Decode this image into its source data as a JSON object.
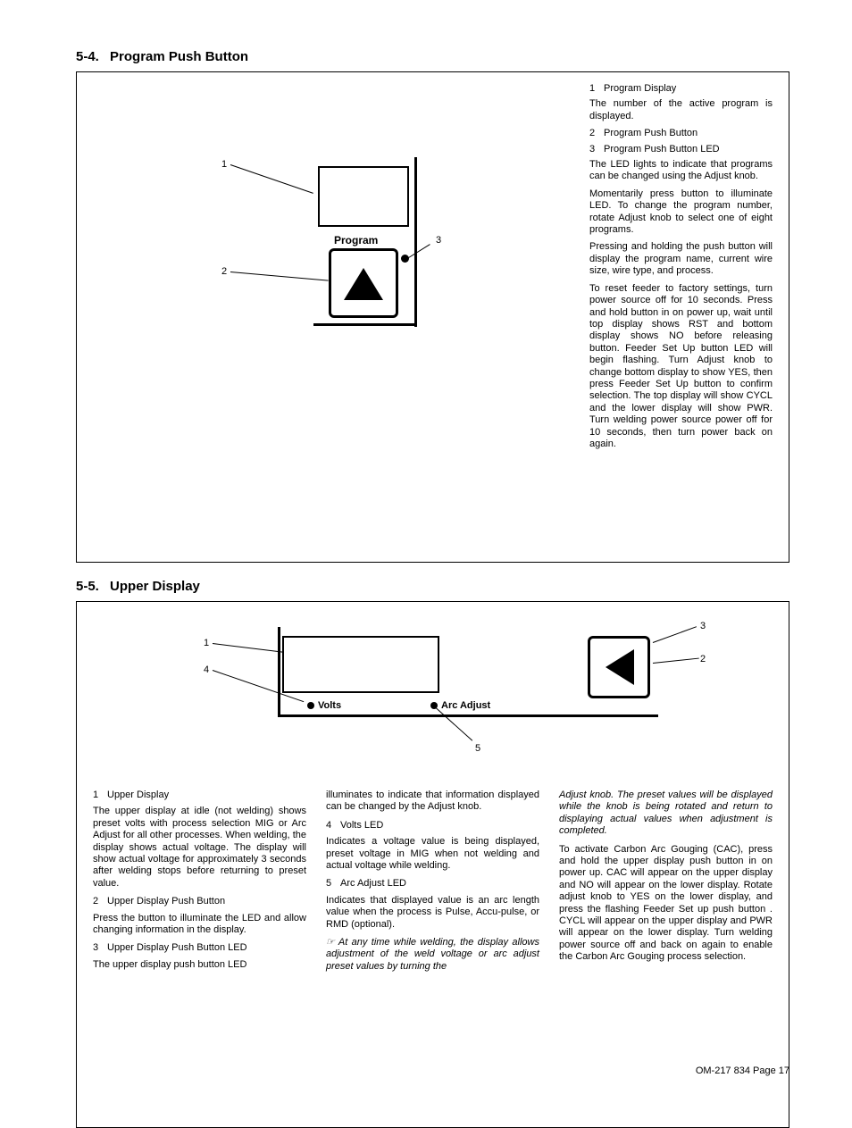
{
  "section1": {
    "number": "5-4.",
    "title": "Program Push Button",
    "diagram": {
      "callout1": "1",
      "callout2": "2",
      "callout3": "3",
      "label": "Program"
    },
    "items": [
      {
        "n": "1",
        "t": "Program Display"
      },
      {
        "n": "2",
        "t": "Program Push Button"
      },
      {
        "n": "3",
        "t": "Program Push Button LED"
      }
    ],
    "p1": "The number of the active program is displayed.",
    "p2": "The LED lights to indicate that programs can be changed using the Adjust knob.",
    "p3": "Momentarily press button to illuminate LED. To change the program number, rotate Adjust knob to select one of eight programs.",
    "p4": "Pressing and holding the push button will display the program name, current wire size, wire type, and process.",
    "p5": "To reset feeder to factory settings, turn power source off for 10 seconds. Press and hold button in on power up, wait until top display shows RST and bottom display shows NO before releasing button. Feeder Set Up button LED will begin flashing. Turn Adjust knob to change bottom display to show YES, then press Feeder Set Up button to confirm selection. The top display will show CYCL and the lower display will show PWR. Turn welding power source power off for 10 seconds, then turn power back on again."
  },
  "section2": {
    "number": "5-5.",
    "title": "Upper Display",
    "diagram": {
      "c1": "1",
      "c2": "2",
      "c3": "3",
      "c4": "4",
      "c5": "5",
      "volts": "Volts",
      "arc": "Arc Adjust"
    },
    "col1": {
      "i1n": "1",
      "i1t": "Upper Display",
      "p1": "The upper display at idle (not welding) shows preset volts with process selection MIG or Arc Adjust for all other processes. When welding, the display shows actual voltage. The display will show actual voltage for approximately 3 seconds after welding stops before returning to preset value.",
      "i2n": "2",
      "i2t": "Upper Display Push Button",
      "p2": "Press the button to illuminate the LED and allow changing information in the display.",
      "i3n": "3",
      "i3t": "Upper Display Push Button LED",
      "p3": "The upper display push button LED"
    },
    "col2": {
      "p1": "illuminates to indicate that information displayed can be changed by the Adjust knob.",
      "i4n": "4",
      "i4t": "Volts LED",
      "p2": "Indicates a voltage value is being displayed, preset voltage in MIG when not welding and actual voltage while welding.",
      "i5n": "5",
      "i5t": "Arc Adjust LED",
      "p3": "Indicates that displayed value is an arc length value when the process is Pulse, Accu-pulse, or RMD (optional).",
      "note": "At any time while welding, the display allows adjustment of the weld voltage or arc adjust preset values by turning the"
    },
    "col3": {
      "noteCont": "Adjust knob. The preset values will be displayed while the knob is being rotated and return to displaying actual values when adjustment is completed.",
      "p1": "To activate Carbon Arc Gouging (CAC), press and hold the upper display push button in on power up. CAC will appear on the upper display and NO will appear on the lower display. Rotate adjust knob to YES on the lower display, and press the flashing Feeder Set up push button . CYCL will appear on the upper display and PWR will appear on the lower display. Turn welding power source off and back on again to enable the Carbon Arc Gouging process selection."
    }
  },
  "footer": "OM-217 834 Page 17"
}
